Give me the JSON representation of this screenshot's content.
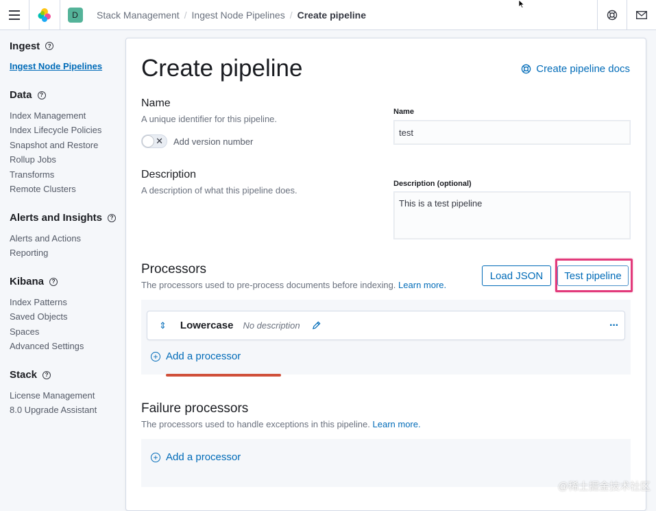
{
  "header": {
    "space_initial": "D",
    "breadcrumbs": [
      "Stack Management",
      "Ingest Node Pipelines",
      "Create pipeline"
    ],
    "icons": [
      "menu-icon",
      "elastic-logo",
      "help-icon",
      "mail-icon"
    ]
  },
  "sidebar": {
    "groups": [
      {
        "title": "Ingest",
        "items": [
          "Ingest Node Pipelines"
        ]
      },
      {
        "title": "Data",
        "items": [
          "Index Management",
          "Index Lifecycle Policies",
          "Snapshot and Restore",
          "Rollup Jobs",
          "Transforms",
          "Remote Clusters"
        ]
      },
      {
        "title": "Alerts and Insights",
        "items": [
          "Alerts and Actions",
          "Reporting"
        ]
      },
      {
        "title": "Kibana",
        "items": [
          "Index Patterns",
          "Saved Objects",
          "Spaces",
          "Advanced Settings"
        ]
      },
      {
        "title": "Stack",
        "items": [
          "License Management",
          "8.0 Upgrade Assistant"
        ]
      }
    ]
  },
  "main": {
    "title": "Create pipeline",
    "docs_link": "Create pipeline docs",
    "name_section": {
      "title": "Name",
      "description": "A unique identifier for this pipeline.",
      "toggle_label": "Add version number",
      "field_label": "Name",
      "field_value": "test"
    },
    "description_section": {
      "title": "Description",
      "description": "A description of what this pipeline does.",
      "field_label": "Description (optional)",
      "field_value": "This is a test pipeline"
    },
    "processors": {
      "title": "Processors",
      "description": "The processors used to pre-process documents before indexing.",
      "learn_more": "Learn more.",
      "load_json": "Load JSON",
      "test_pipeline": "Test pipeline",
      "items": [
        {
          "name": "Lowercase",
          "description": "No description"
        }
      ],
      "add_label": "Add a processor"
    },
    "failure_processors": {
      "title": "Failure processors",
      "description": "The processors used to handle exceptions in this pipeline.",
      "learn_more": "Learn more.",
      "add_label": "Add a processor"
    }
  },
  "colors": {
    "accent": "#006bb8",
    "highlight": "#e23a7b",
    "annotation": "#d0503a"
  },
  "watermark": "@稀土掘金技术社区"
}
